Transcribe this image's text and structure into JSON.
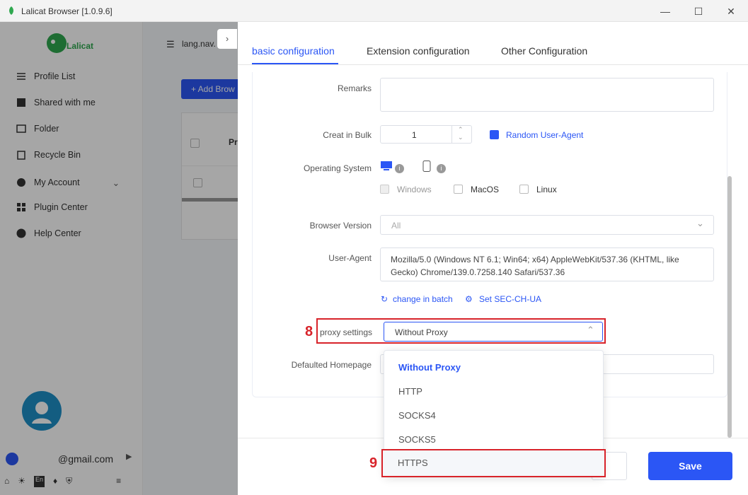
{
  "window": {
    "title": "Lalicat Browser  [1.0.9.6]"
  },
  "sidebar": {
    "logo_text": "Lalicat",
    "items": [
      {
        "label": "Profile List",
        "icon": "list-icon"
      },
      {
        "label": "Shared with me",
        "icon": "download-icon"
      },
      {
        "label": "Folder",
        "icon": "folder-icon"
      },
      {
        "label": "Recycle Bin",
        "icon": "trash-icon"
      },
      {
        "label": "My Account",
        "icon": "account-icon"
      },
      {
        "label": "Plugin Center",
        "icon": "plugin-icon"
      },
      {
        "label": "Help Center",
        "icon": "help-icon"
      }
    ],
    "user_email": "@gmail.com"
  },
  "behind": {
    "breadcrumb": "lang.nav.",
    "add_button": "+ Add Brow",
    "col_header": "Pr"
  },
  "drawer": {
    "tabs": [
      "basic configuration",
      "Extension configuration",
      "Other Configuration"
    ],
    "form": {
      "remarks_label": "Remarks",
      "bulk_label": "Creat in Bulk",
      "bulk_value": "1",
      "random_ua_label": "Random User-Agent",
      "os_label": "Operating System",
      "os_options": [
        "Windows",
        "MacOS",
        "Linux"
      ],
      "browser_version_label": "Browser Version",
      "browser_version_value": "All",
      "ua_label": "User-Agent",
      "ua_value": "Mozilla/5.0 (Windows NT 6.1; Win64; x64) AppleWebKit/537.36 (KHTML, like Gecko) Chrome/139.0.7258.140 Safari/537.36",
      "change_batch": "change in batch",
      "set_sec": "Set SEC-CH-UA",
      "proxy_label": "proxy settings",
      "proxy_value": "Without Proxy",
      "homepage_label": "Defaulted Homepage"
    },
    "proxy_options": [
      "Without Proxy",
      "HTTP",
      "SOCKS4",
      "SOCKS5",
      "HTTPS"
    ],
    "save_label": "Save"
  },
  "annotations": {
    "step8": "8",
    "step9": "9"
  },
  "colors": {
    "accent": "#2b56f5",
    "highlight": "#d8232a"
  }
}
